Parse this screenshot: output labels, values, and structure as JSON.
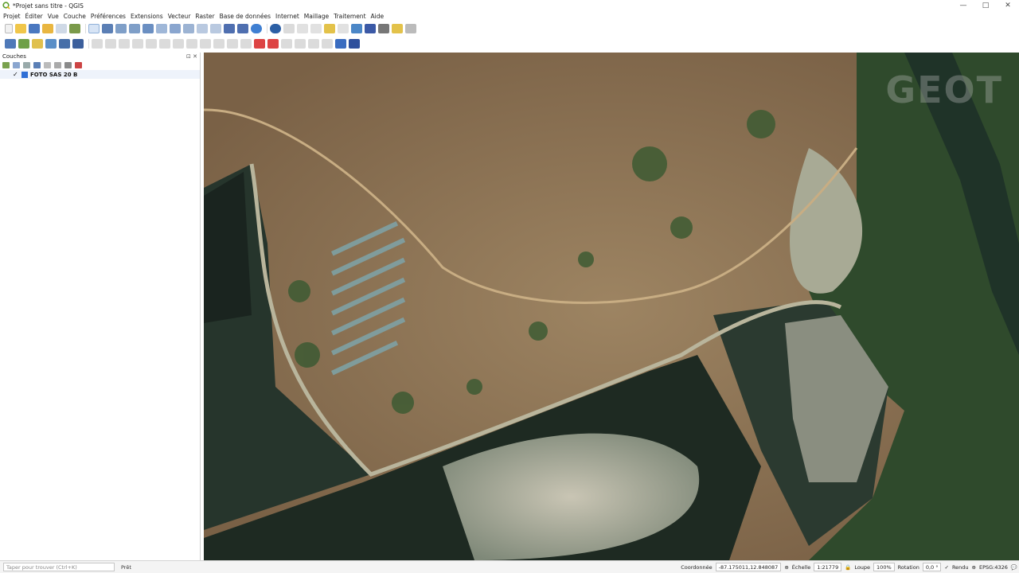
{
  "window": {
    "title": "*Projet sans titre - QGIS",
    "controls": {
      "minimize": "—",
      "maximize": "□",
      "close": "✕"
    }
  },
  "menubar": {
    "items": [
      "Projet",
      "Éditer",
      "Vue",
      "Couche",
      "Préférences",
      "Extensions",
      "Vecteur",
      "Raster",
      "Base de données",
      "Internet",
      "Maillage",
      "Traitement",
      "Aide"
    ]
  },
  "layers_panel": {
    "title": "Couches",
    "controls": "⊡ ✕",
    "layers": [
      {
        "name": "FOTO SAS 20 B",
        "checked": true
      }
    ]
  },
  "statusbar": {
    "locator_placeholder": "Taper pour trouver (Ctrl+K)",
    "ready": "Prêt",
    "coordinate_label": "Coordonnée",
    "coordinate_value": "-87.175011,12.848087",
    "scale_label": "Échelle",
    "scale_value": "1:21779",
    "magnifier_label": "Loupe",
    "magnifier_value": "100%",
    "rotation_label": "Rotation",
    "rotation_value": "0,0 °",
    "render_label": "Rendu",
    "crs": "EPSG:4326"
  },
  "watermark": {
    "text": "GEOT"
  },
  "colors": {
    "accent": "#2f6fd6",
    "map_land": "#8b7257",
    "map_water": "#1e2a22"
  }
}
